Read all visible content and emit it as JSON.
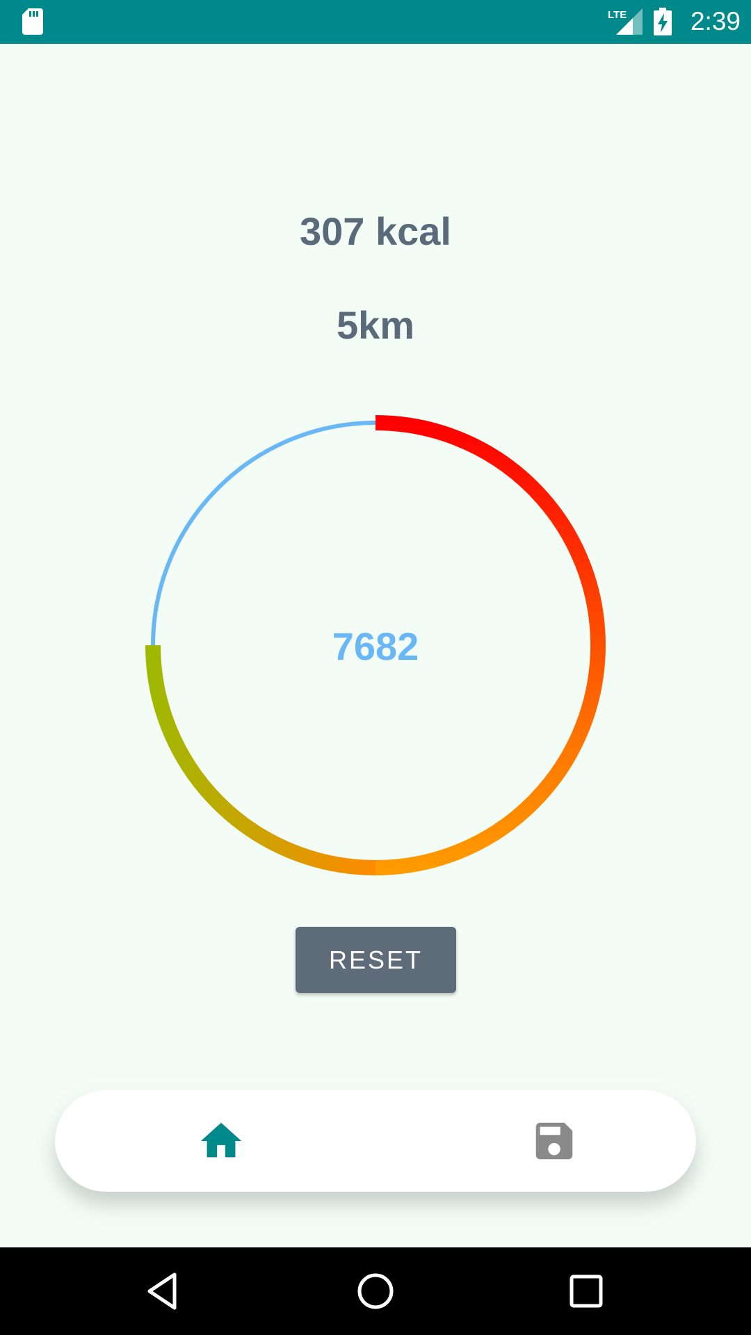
{
  "status_bar": {
    "time": "2:39",
    "network_label": "LTE",
    "icons": [
      "sd-card-icon",
      "lte-signal-icon",
      "battery-charging-icon"
    ],
    "color": "#00898a"
  },
  "stats": {
    "calories": "307 kcal",
    "distance": "5km"
  },
  "progress_ring": {
    "steps": "7682",
    "progress_fraction": 0.75,
    "track_color": "#6ab7f5",
    "gradient_start_color": "#ff0000",
    "gradient_end_color": "#a0b800"
  },
  "actions": {
    "reset_label": "RESET"
  },
  "bottom_nav": {
    "items": [
      {
        "icon": "home-icon",
        "active": true,
        "color": "#00898a"
      },
      {
        "icon": "save-icon",
        "active": false,
        "color": "#8a8a8a"
      }
    ]
  },
  "system_nav": {
    "icons": [
      "back-icon",
      "home-circle-icon",
      "recents-icon"
    ]
  }
}
